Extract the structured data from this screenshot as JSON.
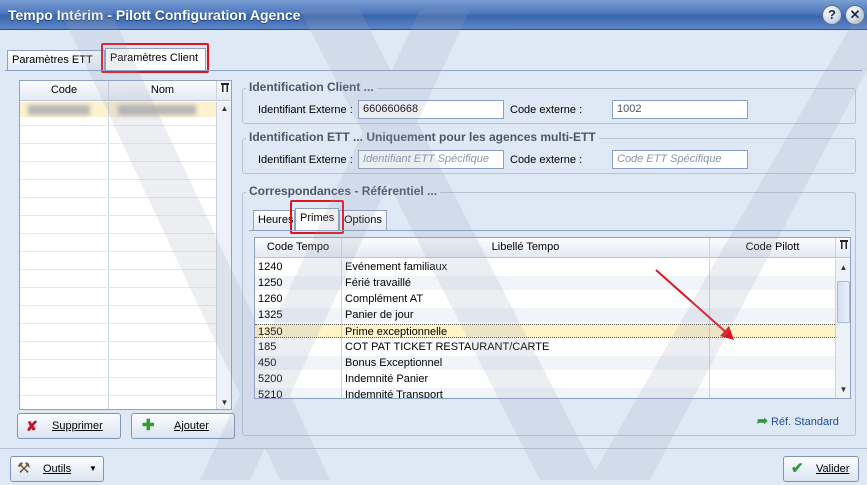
{
  "window": {
    "title": "Tempo Intérim - Pilott Configuration Agence",
    "help_btn": "?",
    "close_btn": "✕"
  },
  "main_tabs": [
    {
      "label": "Paramètres ETT"
    },
    {
      "label": "Paramètres Client"
    }
  ],
  "client_grid": {
    "col_code": "Code",
    "col_nom": "Nom"
  },
  "left_buttons": {
    "delete": "Supprimer",
    "add": "Ajouter"
  },
  "ident_client": {
    "title": "Identification Client ...",
    "ext_id_label": "Identifiant Externe :",
    "ext_id_value": "660660668",
    "code_label": "Code externe :",
    "code_value": "1002"
  },
  "ident_ett": {
    "title": "Identification ETT ... Uniquement pour les agences multi-ETT",
    "ext_id_label": "Identifiant Externe :",
    "ext_id_placeholder": "Identifiant ETT Spécifique",
    "code_label": "Code externe :",
    "code_placeholder": "Code ETT Spécifique"
  },
  "correspondances": {
    "title": "Correspondances - Référentiel ...",
    "tabs": [
      {
        "label": "Heures"
      },
      {
        "label": "Primes"
      },
      {
        "label": "Options"
      }
    ],
    "columns": {
      "code": "Code Tempo",
      "libelle": "Libellé Tempo",
      "pilott": "Code Pilott"
    },
    "rows": [
      {
        "code": "1240",
        "libelle": "Evénement familiaux",
        "pilott": ""
      },
      {
        "code": "1250",
        "libelle": "Férié travaillé",
        "pilott": ""
      },
      {
        "code": "1260",
        "libelle": "Complément AT",
        "pilott": ""
      },
      {
        "code": "1325",
        "libelle": "Panier de jour",
        "pilott": ""
      },
      {
        "code": "1350",
        "libelle": "Prime exceptionnelle",
        "pilott": ""
      },
      {
        "code": "185",
        "libelle": "COT PAT TICKET RESTAURANT/CARTE",
        "pilott": ""
      },
      {
        "code": "450",
        "libelle": "Bonus Exceptionnel",
        "pilott": ""
      },
      {
        "code": "5200",
        "libelle": "Indemnité Panier",
        "pilott": ""
      },
      {
        "code": "5210",
        "libelle": "Indemnité Transport",
        "pilott": ""
      }
    ],
    "ref_standard": "Réf. Standard"
  },
  "bottom": {
    "outils": "Outils",
    "valider": "Valider"
  },
  "colors": {
    "title_bar": "#4e78bd",
    "highlight": "#e0141c",
    "selected_row": "#fff3c8"
  }
}
